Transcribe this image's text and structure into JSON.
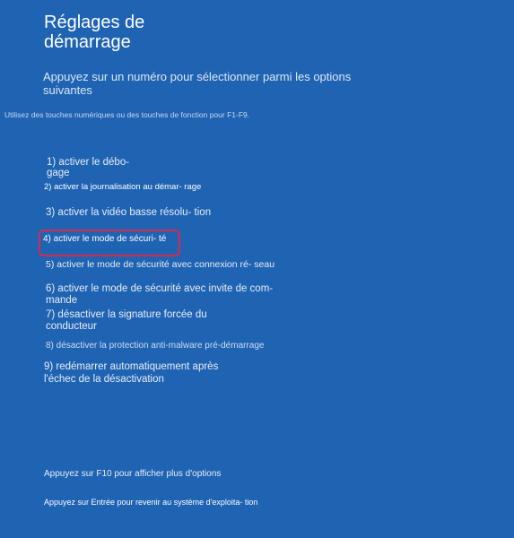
{
  "page": {
    "title": "Réglages de démarrage",
    "subtitle": "Appuyez sur un numéro pour sélectionner parmi les options suivantes",
    "hint": "Utilisez des touches numériques ou des touches de fonction pour F1-F9."
  },
  "options": [
    {
      "label": "1) activer le débo- gage"
    },
    {
      "label": "2) activer la journalisation au démar- rage"
    },
    {
      "label": "3) activer la vidéo basse résolu- tion"
    },
    {
      "label": "4) activer le mode de sécuri- té"
    },
    {
      "label": "5) activer le mode de sécurité avec connexion ré- seau"
    },
    {
      "label": "6) activer le mode de sécurité avec invite de com- mande"
    },
    {
      "label": "7) désactiver la signature forcée du conducteur"
    },
    {
      "label": "8) désactiver la protection anti-malware pré-démarrage"
    },
    {
      "label": "9) redémarrer automatiquement après l'échec de la désactivation"
    }
  ],
  "selection": {
    "highlight_color": "#d42b4c"
  },
  "footer": {
    "more_options": "Appuyez sur F10 pour afficher plus d'options",
    "return": "Appuyez sur Entrée pour revenir au système d'exploita- tion"
  },
  "colors": {
    "background": "#1f63b3",
    "text": "#e8eef8"
  }
}
